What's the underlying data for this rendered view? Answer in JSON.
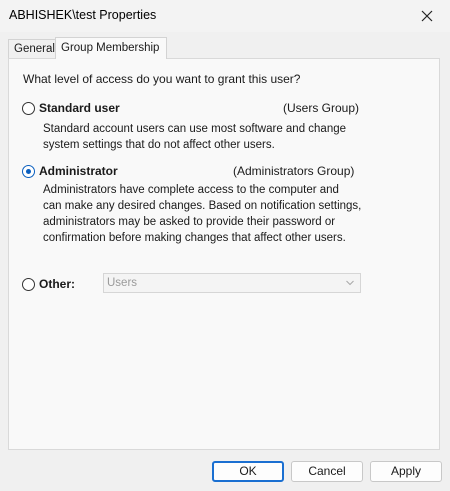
{
  "window": {
    "title": "ABHISHEK\\test Properties",
    "close_icon": "close-icon"
  },
  "tabs": [
    {
      "label": "General",
      "selected": false
    },
    {
      "label": "Group Membership",
      "selected": true
    }
  ],
  "panel": {
    "question": "What level of access do you want to grant this user?",
    "options": {
      "standard": {
        "label": "Standard user",
        "group": "(Users Group)",
        "selected": false,
        "description_lines": [
          "Standard account users can use most software and change",
          "system settings that do not affect other users."
        ]
      },
      "administrator": {
        "label": "Administrator",
        "group": "(Administrators Group)",
        "selected": true,
        "description_lines": [
          "Administrators have complete access to the computer and",
          "can make any desired changes. Based on notification settings,",
          "administrators may be asked to provide their password or",
          "confirmation before making changes that affect other users."
        ]
      },
      "other": {
        "label": "Other:",
        "selected": false,
        "combo_value": "Users",
        "combo_enabled": false
      }
    }
  },
  "buttons": {
    "ok": "OK",
    "cancel": "Cancel",
    "apply": "Apply"
  },
  "colors": {
    "accent": "#0a5fbf",
    "default_button_border": "#1a6fd1"
  }
}
